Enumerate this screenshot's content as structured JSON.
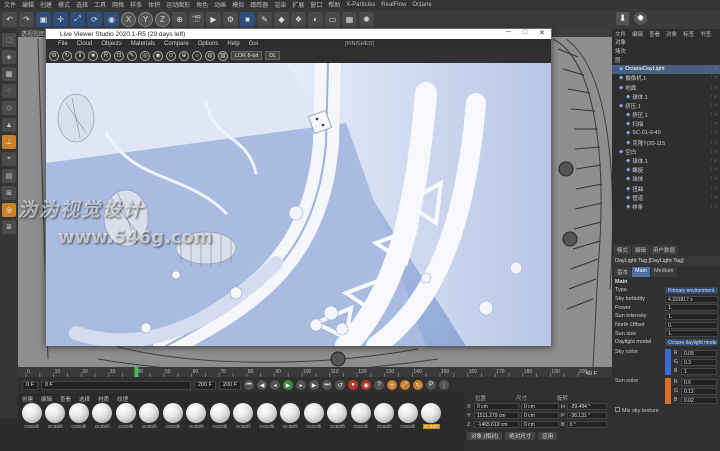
{
  "menubar": [
    "文件",
    "编辑",
    "创建",
    "模式",
    "选择",
    "工具",
    "网格",
    "样条",
    "体积",
    "运动图形",
    "角色",
    "动画",
    "模拟",
    "跟踪器",
    "渲染",
    "扩展",
    "窗口",
    "帮助",
    "X-Particles",
    "RealFlow",
    "Octane"
  ],
  "toolbar": {
    "axis_x": "X",
    "axis_y": "Y",
    "axis_z": "Z"
  },
  "viewport": {
    "header": "透视视图"
  },
  "live_viewer": {
    "title": "Live Viewer Studio 2020.1-R5 (29 days left)",
    "menu": [
      "File",
      "Cloud",
      "Objects",
      "Materials",
      "Compare",
      "Options",
      "Help",
      "Gui"
    ],
    "status": "[FINISHED]",
    "kernel_select": "LDR 8-bit",
    "mode_select": "DL",
    "win_min": "─",
    "win_max": "□",
    "win_close": "✕"
  },
  "watermark": {
    "text": "沩沩视觉设计",
    "url": "www.546g.com"
  },
  "object_manager": {
    "menu": [
      "文件",
      "编辑",
      "查看",
      "对象",
      "标签",
      "书签"
    ],
    "top_items": [
      {
        "label": "对象"
      },
      {
        "label": "场次"
      },
      {
        "label": "层"
      }
    ],
    "items": [
      {
        "label": "OctaneDayLight",
        "indent": 0,
        "selected": true
      },
      {
        "label": "摄像机.1",
        "indent": 0,
        "selected": false
      },
      {
        "label": "地面",
        "indent": 0,
        "selected": false
      },
      {
        "label": "球体.1",
        "indent": 1,
        "selected": false
      },
      {
        "label": "挤压.1",
        "indent": 0,
        "selected": false
      },
      {
        "label": "挤压.1",
        "indent": 1,
        "selected": false
      },
      {
        "label": "扫描",
        "indent": 1,
        "selected": false
      },
      {
        "label": "SC-01-0-40",
        "indent": 1,
        "selected": false
      },
      {
        "label": "克隆T(20-115",
        "indent": 1,
        "selected": false
      },
      {
        "label": "空白",
        "indent": 0,
        "selected": false
      },
      {
        "label": "球体.1",
        "indent": 1,
        "selected": false
      },
      {
        "label": "螺旋",
        "indent": 1,
        "selected": false
      },
      {
        "label": "球体",
        "indent": 1,
        "selected": false
      },
      {
        "label": "扭曲",
        "indent": 1,
        "selected": false
      },
      {
        "label": "管道",
        "indent": 1,
        "selected": false
      },
      {
        "label": "样条",
        "indent": 1,
        "selected": false
      }
    ]
  },
  "attribute_manager": {
    "tabs": [
      "模式",
      "编辑",
      "用户数据"
    ],
    "tag_title": "DayLight Tag [DayLight Tag]",
    "sub_tabs": [
      "基本",
      "Main",
      "Medium"
    ],
    "section": "Main",
    "rows": [
      {
        "label": "Type",
        "value": "Primary environment"
      },
      {
        "label": "Sky turbidity",
        "value": "4.331817 s"
      },
      {
        "label": "Power",
        "value": "1."
      },
      {
        "label": "Sun intensity",
        "value": "1."
      },
      {
        "label": "North Offset",
        "value": "0."
      },
      {
        "label": "Sun size",
        "value": "1."
      },
      {
        "label": "Daylight model",
        "value": "Octane daylight mode"
      }
    ],
    "sky_color_label": "Sky color",
    "sky_color": {
      "R": "0.05",
      "G": "0.3",
      "B": "1"
    },
    "sun_color_label": "Sun color",
    "sun_color": {
      "R": "0.6",
      "G": "0.12",
      "B": "0.02"
    },
    "mix_label": "Mix sky texture",
    "colors": {
      "sky": "#3b6bd1",
      "sun": "#d8702a"
    }
  },
  "timeline": {
    "ticks": [
      "0",
      "5",
      "10",
      "15",
      "20",
      "25",
      "30",
      "35",
      "40",
      "45",
      "50",
      "55",
      "60",
      "65",
      "70",
      "75",
      "80",
      "85",
      "90",
      "95",
      "100",
      "105",
      "110",
      "115",
      "120",
      "125",
      "130",
      "135",
      "140",
      "145",
      "150",
      "155",
      "160",
      "165",
      "170",
      "175",
      "180",
      "185",
      "190",
      "195",
      "200"
    ],
    "current_frame": "40",
    "end_label": "40 F"
  },
  "transport": {
    "start": "0 F",
    "current": "0 F",
    "end": "200 F",
    "end2": "200 F"
  },
  "material_manager": {
    "menu": [
      "创建",
      "编辑",
      "查看",
      "选择",
      "材质",
      "纹理"
    ],
    "materials": [
      "OctDiffi",
      "OctDiffi",
      "OctDiffi",
      "OctDiffi",
      "OctDiffi",
      "OctDiffi",
      "OctDiffi",
      "OctDiffi",
      "OctDiffi",
      "OctDiffi",
      "OctDiffi",
      "OctDiffi",
      "OctDiffi",
      "OctDiffi",
      "OctDiffi",
      "OctDiffi",
      "OctDiffi",
      "OctDiffi"
    ],
    "active_index": 17
  },
  "coordinates": {
    "headers": [
      "位置",
      "尺寸",
      "旋转"
    ],
    "rows": [
      {
        "axis": "X",
        "pos": "0 cm",
        "size": "0 cm",
        "rot_label": "H",
        "rot": "-29.494 °"
      },
      {
        "axis": "Y",
        "pos": "1511.279 cm",
        "size": "0 cm",
        "rot_label": "P",
        "rot": "-38.131 °"
      },
      {
        "axis": "Z",
        "pos": "-1465.619 cm",
        "size": "0 cm",
        "rot_label": "B",
        "rot": "0 °"
      }
    ],
    "mode1": "对象 (相对)",
    "mode2": "绝对尺寸",
    "apply": "应用"
  }
}
